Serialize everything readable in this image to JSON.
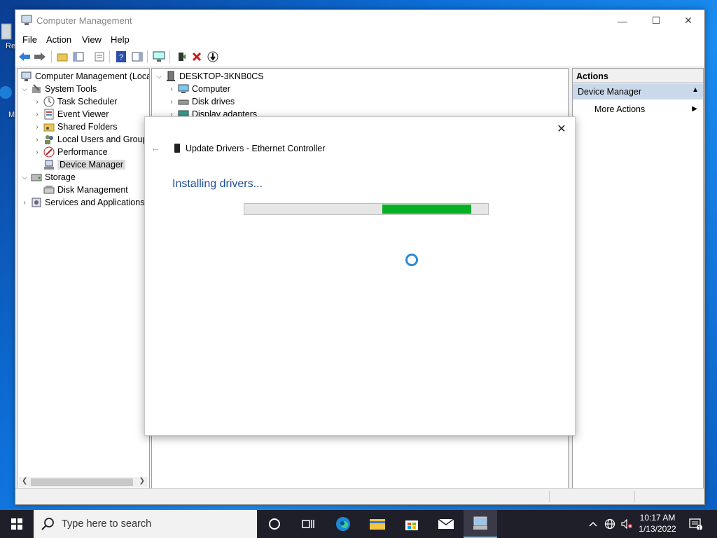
{
  "desktop": {
    "label_top": "Re",
    "label_bottom": "M"
  },
  "window": {
    "title": "Computer Management",
    "menu": [
      "File",
      "Action",
      "View",
      "Help"
    ],
    "controls": {
      "minimize": "—",
      "maximize": "☐",
      "close": "✕"
    }
  },
  "tree": {
    "root": "Computer Management (Local",
    "items": [
      {
        "label": "System Tools"
      },
      {
        "label": "Task Scheduler"
      },
      {
        "label": "Event Viewer"
      },
      {
        "label": "Shared Folders"
      },
      {
        "label": "Local Users and Groups"
      },
      {
        "label": "Performance"
      },
      {
        "label": "Device Manager"
      },
      {
        "label": "Storage"
      },
      {
        "label": "Disk Management"
      },
      {
        "label": "Services and Applications"
      }
    ]
  },
  "devices": {
    "computer_name": "DESKTOP-3KNB0CS",
    "items": [
      "Computer",
      "Disk drives",
      "Display adapters"
    ]
  },
  "actions": {
    "header": "Actions",
    "section": "Device Manager",
    "more": "More Actions"
  },
  "dialog": {
    "title": "Update Drivers - Ethernet Controller",
    "heading": "Installing drivers...",
    "progress": {
      "start_fraction": 0.565,
      "end_fraction": 0.93
    },
    "close": "✕",
    "back": "←"
  },
  "taskbar": {
    "search_placeholder": "Type here to search",
    "time": "10:17 AM",
    "date": "1/13/2022",
    "notification_count": "1"
  },
  "colors": {
    "progress_fill": "#06b025",
    "accent_text": "#1f4e9c",
    "actions_selected": "#c9d9ea",
    "taskbar": "#1f1f2a"
  }
}
